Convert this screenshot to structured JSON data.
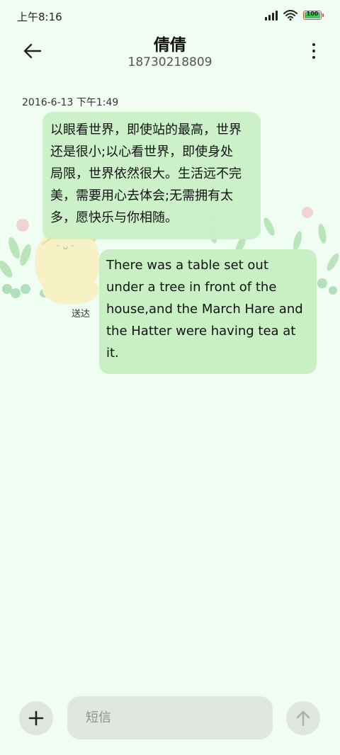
{
  "status_bar": {
    "time": "上午8:16",
    "battery_text": "100",
    "battery_level": 1.0
  },
  "header": {
    "title": "倩倩",
    "subtitle": "18730218809",
    "back_icon": "arrow-left-icon",
    "more_icon": "more-vertical-icon"
  },
  "conversation": {
    "timestamp": "2016-6-13 下午1:49",
    "messages": [
      {
        "lines": [
          "以眼看世界，即使站的最高，世界",
          "还是很小;以心看世界，即使身处",
          "局限，世界依然很大。生活远不完",
          "美，需要用心去体会;无需拥有太",
          "多，愿快乐与你相随。"
        ]
      },
      {
        "lines": [
          "There was a table set out",
          "under a tree in front of the",
          "house,and the March Hare and",
          "the Hatter were having tea at",
          "it."
        ],
        "status": "送达"
      }
    ]
  },
  "composer": {
    "placeholder": "短信",
    "add_icon": "plus-icon",
    "send_icon": "arrow-up-icon"
  },
  "colors": {
    "background": "#f0fdf3",
    "bubble": "#c9f0c5",
    "button_bg": "#dfe6e0"
  }
}
